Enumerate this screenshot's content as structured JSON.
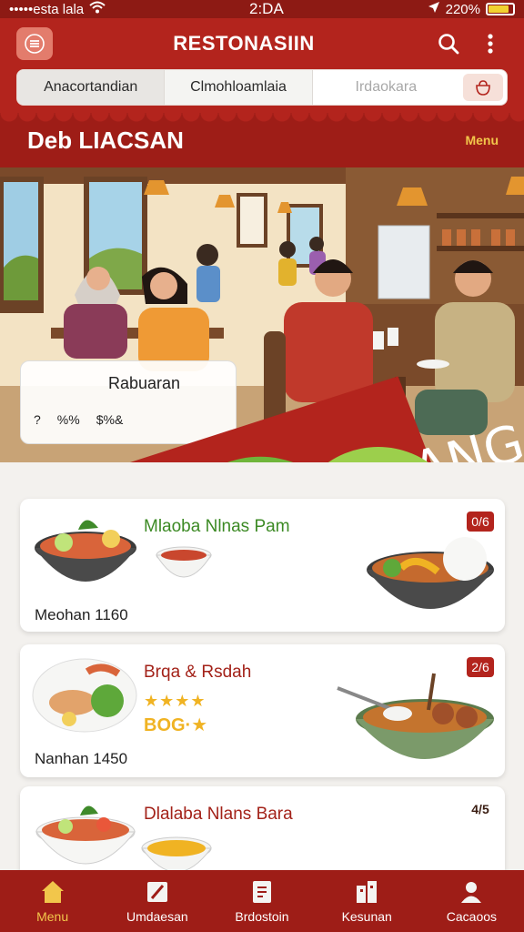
{
  "status_bar": {
    "carrier": "•••••esta lala",
    "time": "2:DA",
    "battery": "220%"
  },
  "app_bar": {
    "title": "RESTONASIIN"
  },
  "segments": [
    {
      "label": "Anacortandian"
    },
    {
      "label": "Clmohloamlaia"
    },
    {
      "label": "Irdaokara"
    }
  ],
  "section": {
    "title": "Deb LIACSAN",
    "link": "Menu"
  },
  "hero": {
    "badge": "DLDEA ANANG",
    "card_title": "Rabuaran",
    "card_meta_a": "?",
    "card_meta_b": "%%",
    "card_meta_c": "$%&"
  },
  "food_items": [
    {
      "name": "Mlaoba Nlnas Pam",
      "price": "Meohan 1160",
      "badge": "0/6"
    },
    {
      "name": "Brqa & Rsdah",
      "price": "Nanhan 1450",
      "badge": "2/6",
      "stars": "★★★★",
      "rating": "BOG·★"
    },
    {
      "name": "Dlalaba Nlans Bara",
      "price": "",
      "badge": "4/5"
    }
  ],
  "nav": [
    {
      "label": "Menu",
      "icon": "home-icon",
      "active": true
    },
    {
      "label": "Umdaesan",
      "icon": "edit-icon"
    },
    {
      "label": "Brdostoin",
      "icon": "receipt-icon"
    },
    {
      "label": "Kesunan",
      "icon": "building-icon"
    },
    {
      "label": "Cacaoos",
      "icon": "user-icon"
    }
  ],
  "colors": {
    "primary": "#b3241d",
    "dark": "#9e1d17",
    "accent": "#f2c64b"
  }
}
